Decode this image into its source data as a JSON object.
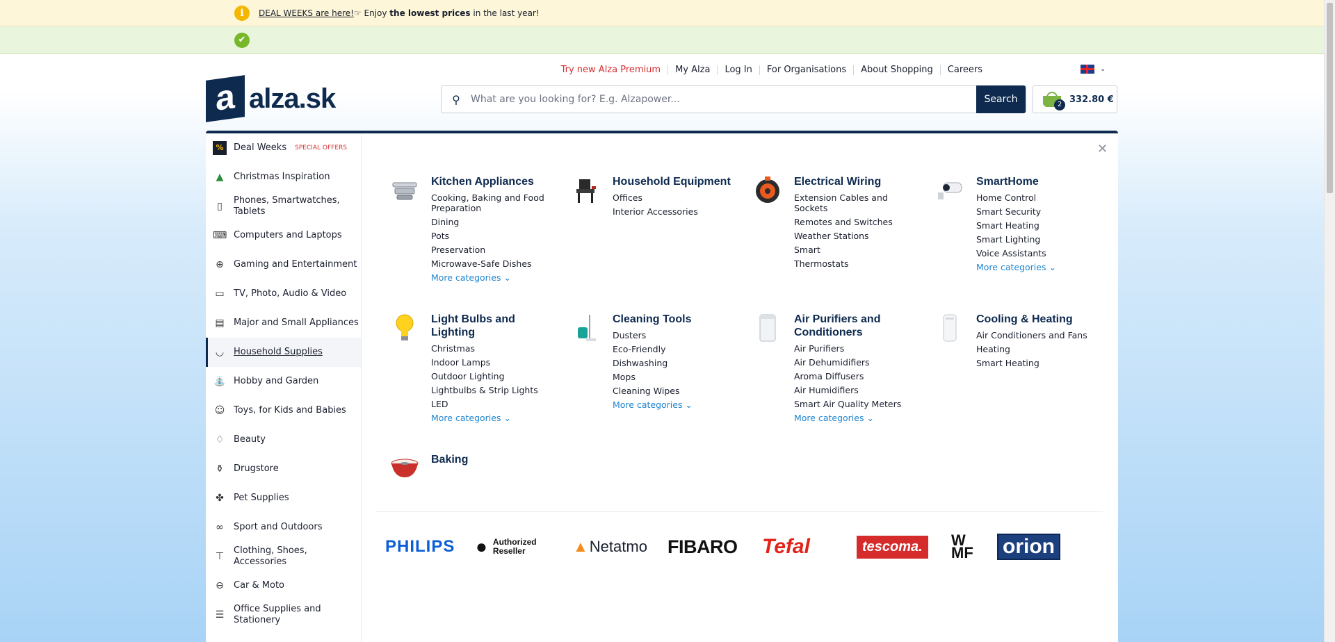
{
  "banners": {
    "deal_link": "DEAL WEEKS are here!",
    "deal_middle": " Enjoy ",
    "deal_bold": "the lowest prices",
    "deal_end": " in the last year!"
  },
  "top_links": [
    "Try new Alza Premium",
    "My Alza",
    "Log In",
    "For Organisations",
    "About Shopping",
    "Careers"
  ],
  "logo": {
    "mark": "a",
    "text": "alza.sk"
  },
  "search": {
    "placeholder": "What are you looking for? E.g. Alzapower...",
    "button": "Search"
  },
  "cart": {
    "count": "2",
    "total": "332.80 €"
  },
  "sidebar": [
    {
      "label": "Deal Weeks",
      "tag": "SPECIAL OFFERS",
      "icon": "percent-badge-icon"
    },
    {
      "label": "Christmas Inspiration",
      "icon": "tree-icon"
    },
    {
      "label": "Phones, Smartwatches, Tablets",
      "icon": "phone-icon"
    },
    {
      "label": "Computers and Laptops",
      "icon": "laptop-icon"
    },
    {
      "label": "Gaming and Entertainment",
      "icon": "gamepad-icon"
    },
    {
      "label": "TV, Photo, Audio & Video",
      "icon": "tv-icon"
    },
    {
      "label": "Major and Small Appliances",
      "icon": "appliance-icon"
    },
    {
      "label": "Household Supplies",
      "icon": "pot-icon",
      "active": true
    },
    {
      "label": "Hobby and Garden",
      "icon": "watering-can-icon"
    },
    {
      "label": "Toys, for Kids and Babies",
      "icon": "toy-icon"
    },
    {
      "label": "Beauty",
      "icon": "beauty-icon"
    },
    {
      "label": "Drugstore",
      "icon": "bottle-icon"
    },
    {
      "label": "Pet Supplies",
      "icon": "paw-icon"
    },
    {
      "label": "Sport and Outdoors",
      "icon": "bike-icon"
    },
    {
      "label": "Clothing, Shoes, Accessories",
      "icon": "shirt-icon"
    },
    {
      "label": "Car & Moto",
      "icon": "car-icon"
    },
    {
      "label": "Office Supplies and Stationery",
      "icon": "office-icon"
    }
  ],
  "categories": [
    {
      "title": "Kitchen Appliances",
      "links": [
        "Cooking, Baking and Food Preparation",
        "Dining",
        "Pots",
        "Preservation",
        "Microwave-Safe Dishes"
      ],
      "more": "More categories"
    },
    {
      "title": "Household Equipment",
      "links": [
        "Offices",
        "Interior Accessories"
      ]
    },
    {
      "title": "Electrical Wiring",
      "links": [
        "Extension Cables and Sockets",
        "Remotes and Switches",
        "Weather Stations",
        "Smart",
        "Thermostats"
      ]
    },
    {
      "title": "SmartHome",
      "links": [
        "Home Control",
        "Smart Security",
        "Smart Heating",
        "Smart Lighting",
        "Voice Assistants"
      ],
      "more": "More categories"
    },
    {
      "title": "Light Bulbs and Lighting",
      "links": [
        "Christmas",
        "Indoor Lamps",
        "Outdoor Lighting",
        "Lightbulbs & Strip Lights",
        "LED"
      ],
      "more": "More categories"
    },
    {
      "title": "Cleaning Tools",
      "links": [
        "Dusters",
        "Eco-Friendly",
        "Dishwashing",
        "Mops",
        "Cleaning Wipes"
      ],
      "more": "More categories"
    },
    {
      "title": "Air Purifiers and Conditioners",
      "links": [
        "Air Purifiers",
        "Air Dehumidifiers",
        "Aroma Diffusers",
        "Air Humidifiers",
        "Smart Air Quality Meters"
      ],
      "more": "More categories"
    },
    {
      "title": "Cooling & Heating",
      "links": [
        "Air Conditioners and Fans",
        "Heating",
        "Smart Heating"
      ]
    },
    {
      "title": "Baking",
      "links": []
    }
  ],
  "brands": {
    "philips": "PHILIPS",
    "apple_line1": "Authorized",
    "apple_line2": "Reseller",
    "netatmo": "Netatmo",
    "fibaro": "FIBARO",
    "tefal": "Tefal",
    "tescoma": "tescoma.",
    "wmf_1": "W",
    "wmf_2": "MF",
    "orion": "orion"
  }
}
